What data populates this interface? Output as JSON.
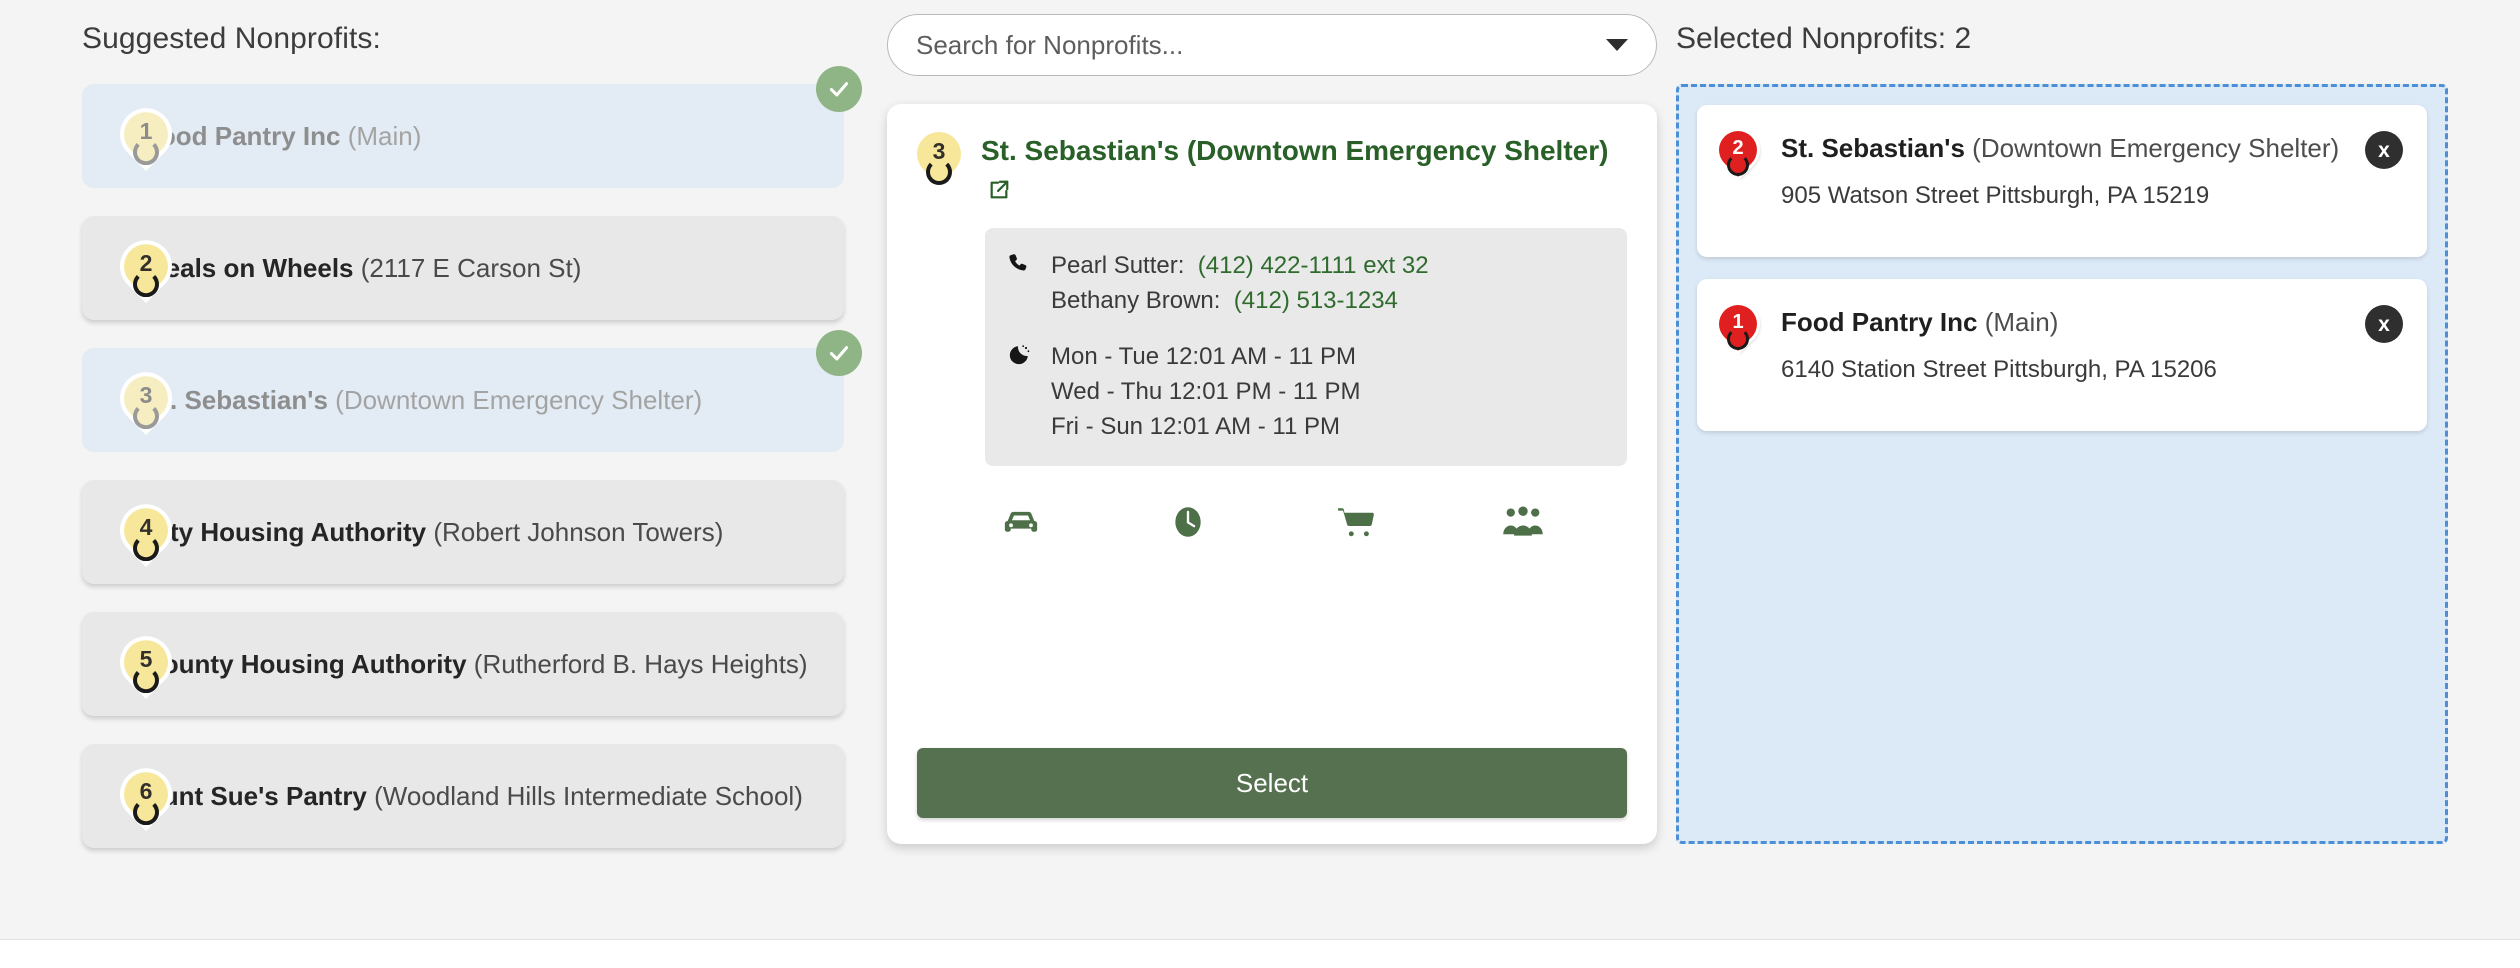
{
  "suggested": {
    "heading": "Suggested Nonprofits:",
    "items": [
      {
        "pin": "1",
        "name": "Food Pantry Inc",
        "location": "(Main)",
        "selected": true
      },
      {
        "pin": "2",
        "name": "Meals on Wheels",
        "location": "(2117 E Carson St)",
        "selected": false
      },
      {
        "pin": "3",
        "name": "St. Sebastian's",
        "location": "(Downtown Emergency Shelter)",
        "selected": true
      },
      {
        "pin": "4",
        "name": "City Housing Authority",
        "location": "(Robert Johnson Towers)",
        "selected": false
      },
      {
        "pin": "5",
        "name": "County Housing Authority",
        "location": "(Rutherford B. Hays Heights)",
        "selected": false
      },
      {
        "pin": "6",
        "name": "Aunt Sue's Pantry",
        "location": "(Woodland Hills Intermediate School)",
        "selected": false
      }
    ]
  },
  "search": {
    "placeholder": "Search for Nonprofits...",
    "caret_icon": "chevron-down-icon"
  },
  "detail": {
    "pin": "3",
    "title": "St. Sebastian's (Downtown Emergency Shelter)",
    "external_link_icon": "external-link-icon",
    "phone_icon": "phone-icon",
    "hours_icon": "clock-icon",
    "contacts": [
      {
        "label": "Pearl Sutter:",
        "value": "(412) 422-1111 ext 32"
      },
      {
        "label": "Bethany Brown:",
        "value": "(412) 513-1234"
      }
    ],
    "hours": [
      "Mon - Tue 12:01 AM - 11 PM",
      "Wed - Thu 12:01 PM - 11 PM",
      "Fri - Sun 12:01 AM - 11 PM"
    ],
    "services": [
      {
        "icon": "car-icon",
        "name": "transportation"
      },
      {
        "icon": "clock-icon",
        "name": "hours"
      },
      {
        "icon": "shopping-cart-icon",
        "name": "groceries"
      },
      {
        "icon": "people-group-icon",
        "name": "community"
      }
    ],
    "select_label": "Select"
  },
  "selected": {
    "heading": "Selected Nonprofits: 2",
    "close_label": "x",
    "items": [
      {
        "pin": "2",
        "name": "St. Sebastian's",
        "location": "(Downtown Emergency Shelter)",
        "address": "905 Watson Street Pittsburgh, PA 15219"
      },
      {
        "pin": "1",
        "name": "Food Pantry Inc",
        "location": "(Main)",
        "address": "6140 Station Street Pittsburgh, PA 15206"
      }
    ]
  },
  "colors": {
    "accent_green": "#55714f",
    "title_green": "#286027",
    "badge_green": "#8fb586",
    "pin_yellow": "#f7e79a",
    "pin_red": "#e02020",
    "selected_blue": "#e3ecf5",
    "dropzone_border": "#4d8fd6"
  }
}
